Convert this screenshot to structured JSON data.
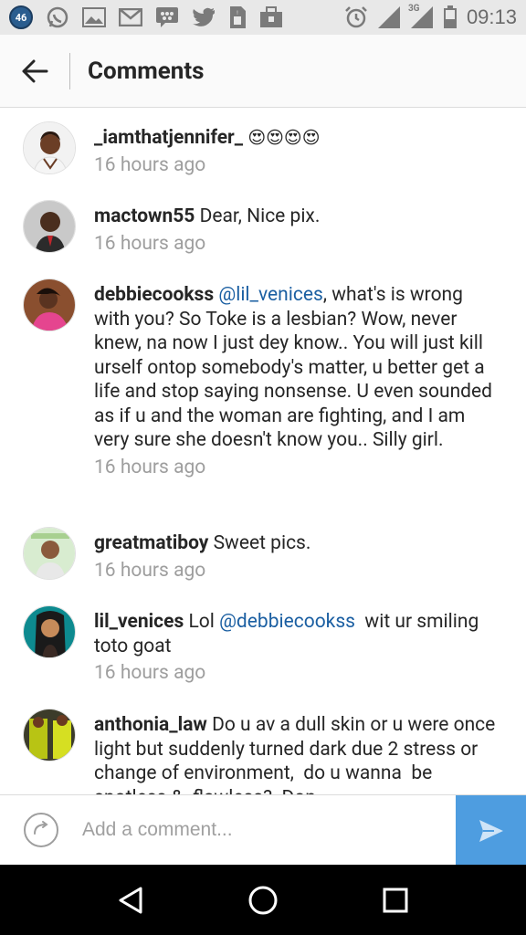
{
  "status_bar": {
    "notification_count": "46",
    "network": "3G",
    "time": "09:13",
    "left_icons": [
      "whatsapp-icon",
      "gallery-icon",
      "gmail-icon",
      "bbm-icon",
      "twitter-icon",
      "sim-icon",
      "briefcase-icon"
    ],
    "right_icons": [
      "alarm-icon",
      "signal-icon",
      "signal-3g-icon",
      "battery-icon"
    ]
  },
  "app_bar": {
    "title": "Comments",
    "back_icon": "back-arrow-icon"
  },
  "comments": [
    {
      "username": "_iamthatjennifer_",
      "text": "",
      "emoji": "😍😍😍😍",
      "time": "16 hours ago"
    },
    {
      "username": "mactown55",
      "text": " Dear, Nice pix.",
      "time": "16 hours ago"
    },
    {
      "username": "debbiecookss",
      "mention": "@lil_venices",
      "text": ", what's is wrong with you? So Toke is a lesbian? Wow, never knew, na now I just dey know.. You will just kill urself ontop somebody's matter, u better get a life and stop saying nonsense. U even sounded as if u and the woman are fighting, and I am very sure she doesn't know you.. Silly girl.",
      "time": "16 hours ago"
    },
    {
      "username": "greatmatiboy",
      "text": " Sweet pics.",
      "time": "16 hours ago"
    },
    {
      "username": "lil_venices",
      "text_before": " Lol ",
      "mention": "@debbiecookss",
      "text": "  wit ur smiling  toto goat",
      "time": "16 hours ago"
    },
    {
      "username": "anthonia_law",
      "text": " Do u av a dull skin or u were once light but suddenly turned dark due 2 stress or  change of environment,  do u wanna  be  spotless &  flawless?  Don",
      "time": ""
    }
  ],
  "input_bar": {
    "placeholder": "Add a comment...",
    "camera_icon": "camera-icon",
    "send_icon": "send-icon"
  },
  "nav_bar": {
    "buttons": [
      "back-nav-icon",
      "home-icon",
      "recents-icon"
    ]
  },
  "colors": {
    "mention": "#1b5fa2",
    "send_button": "#4e9de0",
    "timestamp": "#9e9e9e"
  }
}
